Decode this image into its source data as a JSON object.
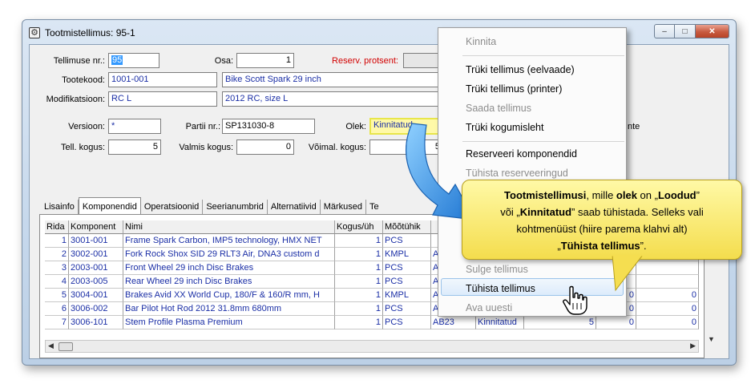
{
  "window": {
    "title": "Tootmistellimus: 95-1",
    "minimize_glyph": "–",
    "maximize_glyph": "□",
    "close_glyph": "✕"
  },
  "form": {
    "order_no_label": "Tellimuse nr.:",
    "order_no": "95",
    "part_label": "Osa:",
    "part": "1",
    "reserve_pct_label": "Reserv. protsent:",
    "product_code_label": "Tootekood:",
    "product_code": "1001-001",
    "product_name": "Bike Scott Spark 29 inch",
    "modification_label": "Modifikatsioon:",
    "modification_code": "RC L",
    "modification_name": "2012 RC, size L",
    "version_label": "Versioon:",
    "version": "*",
    "batch_label": "Partii nr.:",
    "batch": "SP131030-8",
    "status_label": "Olek:",
    "status": "Kinnitatud",
    "order_qty_label": "Tell. kogus:",
    "order_qty": "5",
    "ready_qty_label": "Valmis kogus:",
    "ready_qty": "0",
    "possible_qty_label": "Võimal. kogus:",
    "possible_qty": "5",
    "partial_text": "nte"
  },
  "tabs": [
    "Lisainfo",
    "Komponendid",
    "Operatsioonid",
    "Seerianumbrid",
    "Alternatiivid",
    "Märkused",
    "Te"
  ],
  "grid": {
    "headers": [
      "Rida",
      "Komponent",
      "Nimi",
      "Kogus/üh",
      "Mõõtühik"
    ],
    "rows": [
      {
        "rida": "1",
        "komponent": "3001-001",
        "nimi": "Frame Spark Carbon, IMP5 technology, HMX NET",
        "kogus": "1",
        "yhik": "PCS",
        "c6": "",
        "c7": "",
        "c8": "",
        "c9": "",
        "c10": ""
      },
      {
        "rida": "2",
        "komponent": "3002-001",
        "nimi": "Fork Rock Shox SID 29 RLT3 Air, DNA3 custom d",
        "kogus": "1",
        "yhik": "KMPL",
        "c6": "A",
        "c7": "",
        "c8": "",
        "c9": "",
        "c10": ""
      },
      {
        "rida": "3",
        "komponent": "2003-001",
        "nimi": "Front Wheel 29 inch Disc Brakes",
        "kogus": "1",
        "yhik": "PCS",
        "c6": "A",
        "c7": "",
        "c8": "",
        "c9": "",
        "c10": ""
      },
      {
        "rida": "4",
        "komponent": "2003-005",
        "nimi": "Rear Wheel 29 inch Disc Brakes",
        "kogus": "1",
        "yhik": "PCS",
        "c6": "A",
        "c7": "",
        "c8": "",
        "c9": "",
        "c10": ""
      },
      {
        "rida": "5",
        "komponent": "3004-001",
        "nimi": "Brakes Avid XX World Cup, 180/F & 160/R mm, H",
        "kogus": "1",
        "yhik": "KMPL",
        "c6": "A",
        "c7": "",
        "c8": "",
        "c9": "0",
        "c10": "0"
      },
      {
        "rida": "6",
        "komponent": "3006-002",
        "nimi": "Bar Pilot Hot Rod 2012 31.8mm 680mm",
        "kogus": "1",
        "yhik": "PCS",
        "c6": "A",
        "c7": "",
        "c8": "",
        "c9": "0",
        "c10": "0"
      },
      {
        "rida": "7",
        "komponent": "3006-101",
        "nimi": "Stem Profile Plasma Premium",
        "kogus": "1",
        "yhik": "PCS",
        "c6": "AB23",
        "c7": "Kinnitatud",
        "c8": "5",
        "c9": "0",
        "c10": "0"
      }
    ],
    "extra_zero_top": "0",
    "extra_zero_row2": "0"
  },
  "context_menu": {
    "items": [
      {
        "label": "Kinnita",
        "enabled": false
      },
      {
        "label": "Trüki tellimus (eelvaade)",
        "enabled": true
      },
      {
        "label": "Trüki tellimus (printer)",
        "enabled": true
      },
      {
        "label": "Saada tellimus",
        "enabled": false
      },
      {
        "label": "Trüki kogumisleht",
        "enabled": true
      },
      {
        "label": "Reserveeri komponendid",
        "enabled": true
      },
      {
        "label": "Tühista reserveeringud",
        "enabled": false
      },
      {
        "label": "Sulge tellimus",
        "enabled": false
      },
      {
        "label": "Tühista tellimus",
        "enabled": true
      },
      {
        "label": "Ava uuesti",
        "enabled": false
      }
    ]
  },
  "callout": {
    "l1_a": "Tootmistellimusi",
    "l1_b": ", mille ",
    "l1_c": "olek",
    "l1_d": " on „",
    "l1_e": "Loodud",
    "l1_f": "”",
    "l2_a": "või „",
    "l2_b": "Kinnitatud",
    "l2_c": "” saab tühistada. Selleks vali",
    "l3": "kohtmenüüst (hiire parema klahvi alt)",
    "l4_a": "„",
    "l4_b": "Tühista tellimus",
    "l4_c": "”."
  },
  "colors": {
    "accent_blue": "#1b2fa6",
    "highlight_yellow": "#fff9a8",
    "callout_yellow": "#f4dd4d",
    "arrow_blue": "#2f8fe0"
  }
}
